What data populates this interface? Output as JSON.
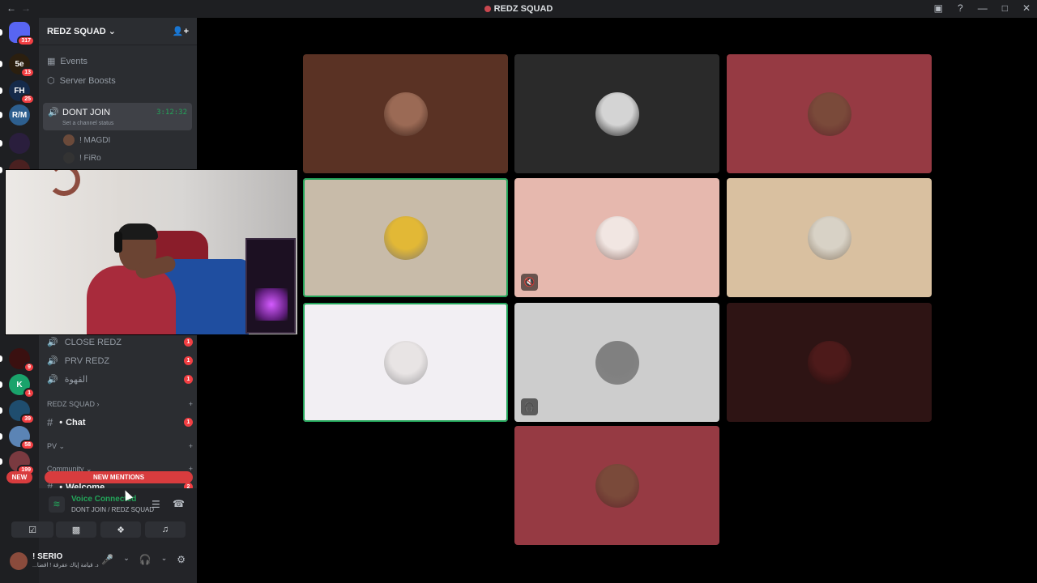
{
  "window": {
    "title": "REDZ SQUAD",
    "accent": "#c9474f"
  },
  "guilds": [
    {
      "label": "",
      "badge": "317",
      "color": "#5865f2"
    },
    {
      "label": "5e",
      "badge": "13",
      "color": "#2b1f0f"
    },
    {
      "label": "FH",
      "badge": "25",
      "color": "#152a4a"
    },
    {
      "label": "R/M",
      "badge": "",
      "color": "#2d5f8f"
    },
    {
      "label": "",
      "badge": "",
      "color": "#2a1e3d"
    },
    {
      "label": "",
      "badge": "",
      "color": "#4a2020"
    },
    {
      "label": "",
      "badge": "9",
      "color": "#3a1010"
    },
    {
      "label": "K",
      "badge": "1",
      "color": "#1aa36b"
    },
    {
      "label": "",
      "badge": "39",
      "color": "#1f4d6e"
    },
    {
      "label": "",
      "badge": "58",
      "color": "#5b84b5"
    },
    {
      "label": "",
      "badge": "199",
      "color": "#7a3a40"
    }
  ],
  "sidebar": {
    "server_name": "REDZ SQUAD",
    "events": "Events",
    "boosts": "Server Boosts",
    "active_channel": "DONT JOIN",
    "active_timer": "3:12:32",
    "channel_status": "Set a channel status",
    "voice_users": [
      "! MAGDI",
      "! FiRo"
    ],
    "channels": [
      {
        "name": "CLOSE REDZ",
        "count": "1"
      },
      {
        "name": "PRV REDZ",
        "count": "1"
      },
      {
        "name": "القهوة",
        "count": "1"
      }
    ],
    "categories": {
      "redz": "REDZ SQUAD",
      "pv": "PV",
      "community": "Community"
    },
    "chat_channel": "Chat",
    "chat_count": "1",
    "welcome_channel": "Welcome",
    "welcome_count": "2",
    "new_label": "NEW",
    "mentions_label": "NEW MENTIONS"
  },
  "voice_panel": {
    "status": "Voice Connected",
    "location": "DONT JOIN / REDZ SQUAD"
  },
  "user_panel": {
    "name": "! SERIO",
    "status": "...د. قيامة إياك عقرقة ! اقضا"
  },
  "tiles": [
    {
      "bg": "#5a3224",
      "av": "#9b6a55",
      "speaking": false,
      "icon": ""
    },
    {
      "bg": "#2a2a2a",
      "av": "#d4d4d4",
      "speaking": false,
      "icon": ""
    },
    {
      "bg": "#963a43",
      "av": "#7a4a3a",
      "speaking": false,
      "icon": ""
    },
    {
      "bg": "#c8bba9",
      "av": "#e2b836",
      "speaking": true,
      "icon": ""
    },
    {
      "bg": "#e6b8ae",
      "av": "#f1e6e2",
      "speaking": false,
      "icon": "🔇"
    },
    {
      "bg": "#d9c0a0",
      "av": "#d8d2c6",
      "speaking": false,
      "icon": ""
    },
    {
      "bg": "#f2eff3",
      "av": "#e8e4e4",
      "speaking": true,
      "icon": ""
    },
    {
      "bg": "#cdcdcd",
      "av": "#808080",
      "speaking": false,
      "icon": "🎧"
    },
    {
      "bg": "#2e1414",
      "av": "#4d1a1a",
      "speaking": false,
      "icon": ""
    },
    {
      "bg": "#963a43",
      "av": "#7a4a3a",
      "speaking": false,
      "icon": ""
    }
  ]
}
